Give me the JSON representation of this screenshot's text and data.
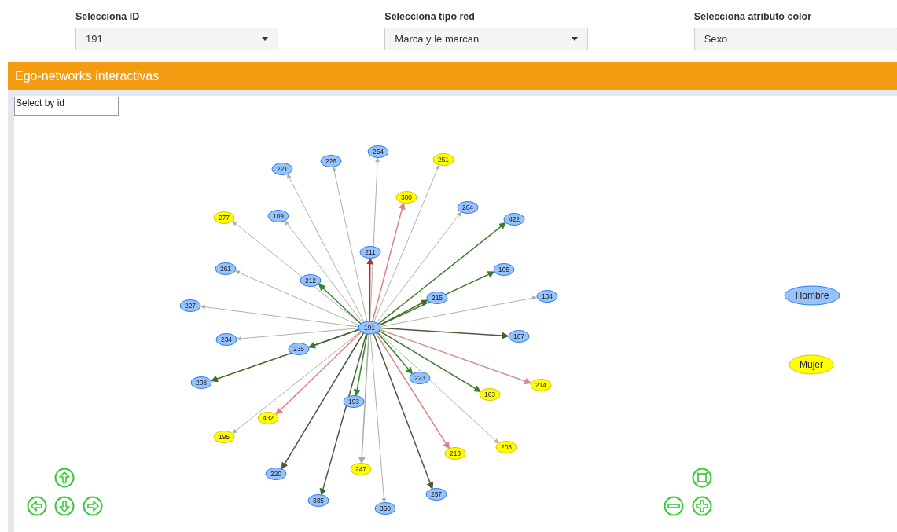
{
  "filters": [
    {
      "label": "Selecciona ID",
      "value": "191"
    },
    {
      "label": "Selecciona tipo red",
      "value": "Marca y le marcan"
    },
    {
      "label": "Selecciona atributo color",
      "value": "Sexo"
    }
  ],
  "panel": {
    "title": "Ego-networks interactivas"
  },
  "search": {
    "placeholder": "Select by id"
  },
  "network": {
    "center": {
      "label": "191",
      "color": "#97c2fc"
    },
    "nodes": [
      {
        "label": "221",
        "color": "#97c2fc",
        "edge": {
          "color": "#b0b0a8"
        }
      },
      {
        "label": "226",
        "color": "#97c2fc",
        "edge": {
          "color": "#b0b0a8"
        }
      },
      {
        "label": "254",
        "color": "#97c2fc",
        "edge": {
          "color": "#b0b0a8"
        }
      },
      {
        "label": "251",
        "color": "#ffff00",
        "edge": {
          "color": "#b0b0a8"
        }
      },
      {
        "label": "300",
        "color": "#ffff00",
        "edge": {
          "color": "#e08080"
        }
      },
      {
        "label": "277",
        "color": "#ffff00",
        "edge": {
          "color": "#b0b0a8"
        }
      },
      {
        "label": "109",
        "color": "#97c2fc",
        "edge": {
          "color": "#b0b0a8"
        }
      },
      {
        "label": "204",
        "color": "#97c2fc",
        "edge": {
          "color": "#b0b0a8"
        }
      },
      {
        "label": "422",
        "color": "#97c2fc",
        "edge": {
          "color": "#3f7a2a"
        }
      },
      {
        "label": "211",
        "color": "#97c2fc",
        "edge": {
          "color": "#b03030"
        }
      },
      {
        "label": "261",
        "color": "#97c2fc",
        "edge": {
          "color": "#b0b0a8"
        }
      },
      {
        "label": "212",
        "color": "#97c2fc",
        "edge": {
          "color": "#2f8a2a"
        }
      },
      {
        "label": "105",
        "color": "#97c2fc",
        "edge": {
          "color": "#3f7a2a"
        }
      },
      {
        "label": "215",
        "color": "#97c2fc",
        "edge": {
          "color": "#3f6a2a"
        }
      },
      {
        "label": "227",
        "color": "#97c2fc",
        "edge": {
          "color": "#b0b0a8"
        }
      },
      {
        "label": "104",
        "color": "#97c2fc",
        "edge": {
          "color": "#b0b0a8"
        }
      },
      {
        "label": "234",
        "color": "#97c2fc",
        "edge": {
          "color": "#b0b0a8"
        }
      },
      {
        "label": "235",
        "color": "#97c2fc",
        "edge": {
          "color": "#2f8a2a"
        }
      },
      {
        "label": "167",
        "color": "#97c2fc",
        "edge": {
          "color": "#4a5a3a"
        }
      },
      {
        "label": "208",
        "color": "#97c2fc",
        "edge": {
          "color": "#3f6a2a"
        }
      },
      {
        "label": "223",
        "color": "#97c2fc",
        "edge": {
          "color": "#2f8a2a"
        }
      },
      {
        "label": "163",
        "color": "#ffff00",
        "edge": {
          "color": "#3f7a2a"
        }
      },
      {
        "label": "214",
        "color": "#ffff00",
        "edge": {
          "color": "#d09090"
        }
      },
      {
        "label": "432",
        "color": "#ffff00",
        "edge": {
          "color": "#e08080"
        }
      },
      {
        "label": "193",
        "color": "#97c2fc",
        "edge": {
          "color": "#2f8a2a"
        }
      },
      {
        "label": "195",
        "color": "#ffff00",
        "edge": {
          "color": "#b0b0a8"
        }
      },
      {
        "label": "213",
        "color": "#ffff00",
        "edge": {
          "color": "#e08080"
        }
      },
      {
        "label": "203",
        "color": "#ffff00",
        "edge": {
          "color": "#b0b0a8"
        }
      },
      {
        "label": "247",
        "color": "#ffff00",
        "edge": {
          "color": "#a0b0a0"
        }
      },
      {
        "label": "220",
        "color": "#97c2fc",
        "edge": {
          "color": "#4a5a3a"
        }
      },
      {
        "label": "257",
        "color": "#97c2fc",
        "edge": {
          "color": "#4a5a3a"
        }
      },
      {
        "label": "335",
        "color": "#97c2fc",
        "edge": {
          "color": "#4a5a3a"
        }
      },
      {
        "label": "350",
        "color": "#97c2fc",
        "edge": {
          "color": "#b0b0a8"
        }
      }
    ]
  },
  "legend": [
    {
      "label": "Hombre",
      "color": "#97c2fc"
    },
    {
      "label": "Mujer",
      "color": "#ffff00"
    }
  ]
}
